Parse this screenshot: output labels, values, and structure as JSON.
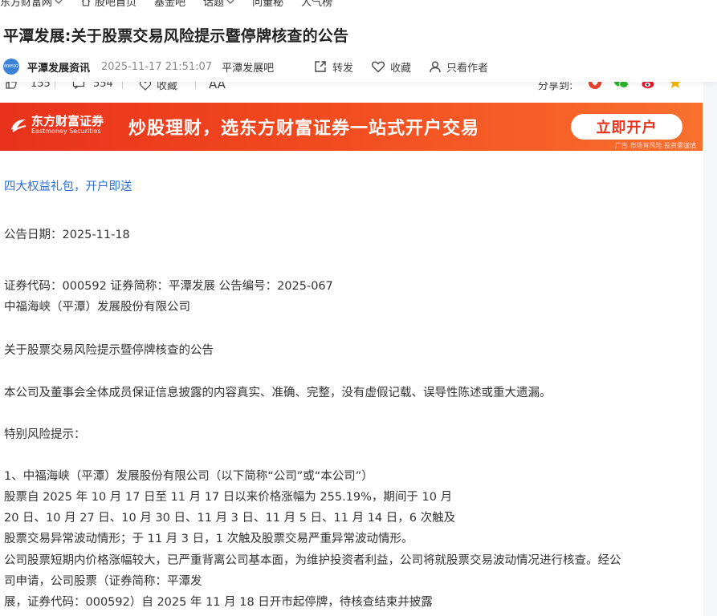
{
  "nav": {
    "items": [
      {
        "label": "东方财富网",
        "has_chevron": true
      },
      {
        "label": "股吧首页",
        "has_home_icon": true
      },
      {
        "label": "基金吧"
      },
      {
        "label": "话题",
        "has_chevron": true
      },
      {
        "label": "问董秘"
      },
      {
        "label": "人气榜"
      }
    ]
  },
  "post": {
    "title": "平潭发展:关于股票交易风险提示暨停牌核查的公告",
    "author_avatar_text": "000592",
    "author": "平潭发展资讯",
    "time": "2025-11-17 21:51:07",
    "bar": "平潭发展吧",
    "actions": {
      "forward": "转发",
      "favorite": "收藏",
      "only_author": "只看作者"
    }
  },
  "stats": {
    "likes": "155",
    "comments": "554",
    "favorite": "收藏",
    "font_size": "AA",
    "share_label": "分享到:",
    "share_icons": [
      "toutiao-icon",
      "wechat-icon",
      "weibo-icon",
      "qzone-icon"
    ]
  },
  "banner": {
    "logo_cn": "东方财富证券",
    "logo_en": "Eastmoney Securities",
    "slogan": "炒股理财，选东方财富证券一站式开户交易",
    "button": "立即开户",
    "disclaimer": "广告 市场有风险 投资需谨慎"
  },
  "article": {
    "promo_link": "四大权益礼包，开户即送",
    "lines": [
      "公告日期：2025-11-18",
      "证券代码：000592 证券简称：平潭发展 公告编号：2025-067",
      "中福海峡（平潭）发展股份有限公司",
      "关于股票交易风险提示暨停牌核查的公告",
      "本公司及董事会全体成员保证信息披露的内容真实、准确、完整，没有虚假记载、误导性陈述或重大遗漏。",
      "特别风险提示：",
      "1、中福海峡（平潭）发展股份有限公司（以下简称“公司”或“本公司”）",
      "股票自 2025 年 10 月 17 日至 11 月 17 日以来价格涨幅为 255.19%，期间于 10 月",
      "20 日、10 月 27 日、10 月 30 日、11 月 3 日、11 月 5 日、11 月 14 日，6 次触及",
      "股票交易异常波动情形；于 11 月 3 日，1 次触及股票交易严重异常波动情形。",
      "公司股票短期内价格涨幅较大，已严重背离公司基本面，为维护投资者利益，公司将就股票交易波动情况进行核查。经公",
      "司申请，公司股票（证券简称：平潭发",
      "展，证券代码：000592）自 2025 年 11 月 18 日开市起停牌，待核查结束并披露"
    ]
  },
  "colors": {
    "banner_red": "#e8321c",
    "banner_orange": "#f8702e",
    "link_blue": "#2d6fd2"
  }
}
